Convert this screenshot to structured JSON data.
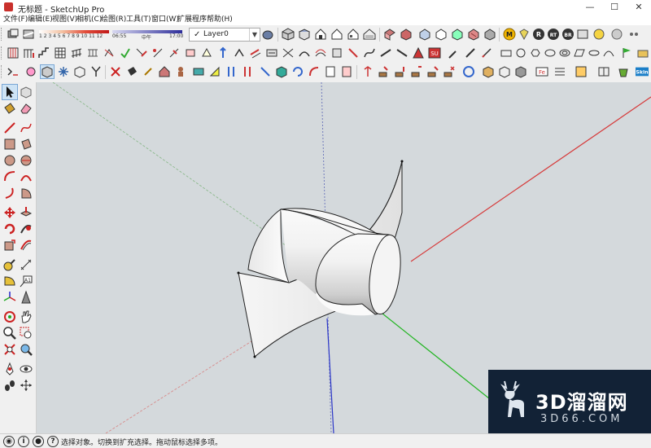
{
  "window": {
    "title": "无标题 - SketchUp Pro",
    "minimize": "—",
    "maximize": "☐",
    "close": "✕"
  },
  "menu": [
    "文件(F)",
    "编辑(E)",
    "视图(V)",
    "相机(C)",
    "绘图(R)",
    "工具(T)",
    "窗口(W)",
    "扩展程序",
    "帮助(H)"
  ],
  "shadows": {
    "months": "1 2 3 4 5 6 7 8 9 10 11 12",
    "time_start": "06:55",
    "time_mid": "中午",
    "time_end": "17:00"
  },
  "layer": {
    "checked": "✓",
    "name": "Layer0",
    "dropdown": "▼"
  },
  "render_icon_labels": [
    "M",
    "R",
    "RT",
    "BR"
  ],
  "skin_label": "Skin",
  "status": {
    "hint": "选择对象。切换到扩充选择。拖动鼠标选择多项。"
  },
  "watermark": {
    "brand": "3D溜溜网",
    "domain": "3D66.COM"
  },
  "colors": {
    "viewport_bg": "#d4d9dc",
    "red_axis": "#d64a4a",
    "green_axis": "#3db33d",
    "blue_axis": "#4a55c8",
    "watermark_bg": "#122236"
  }
}
